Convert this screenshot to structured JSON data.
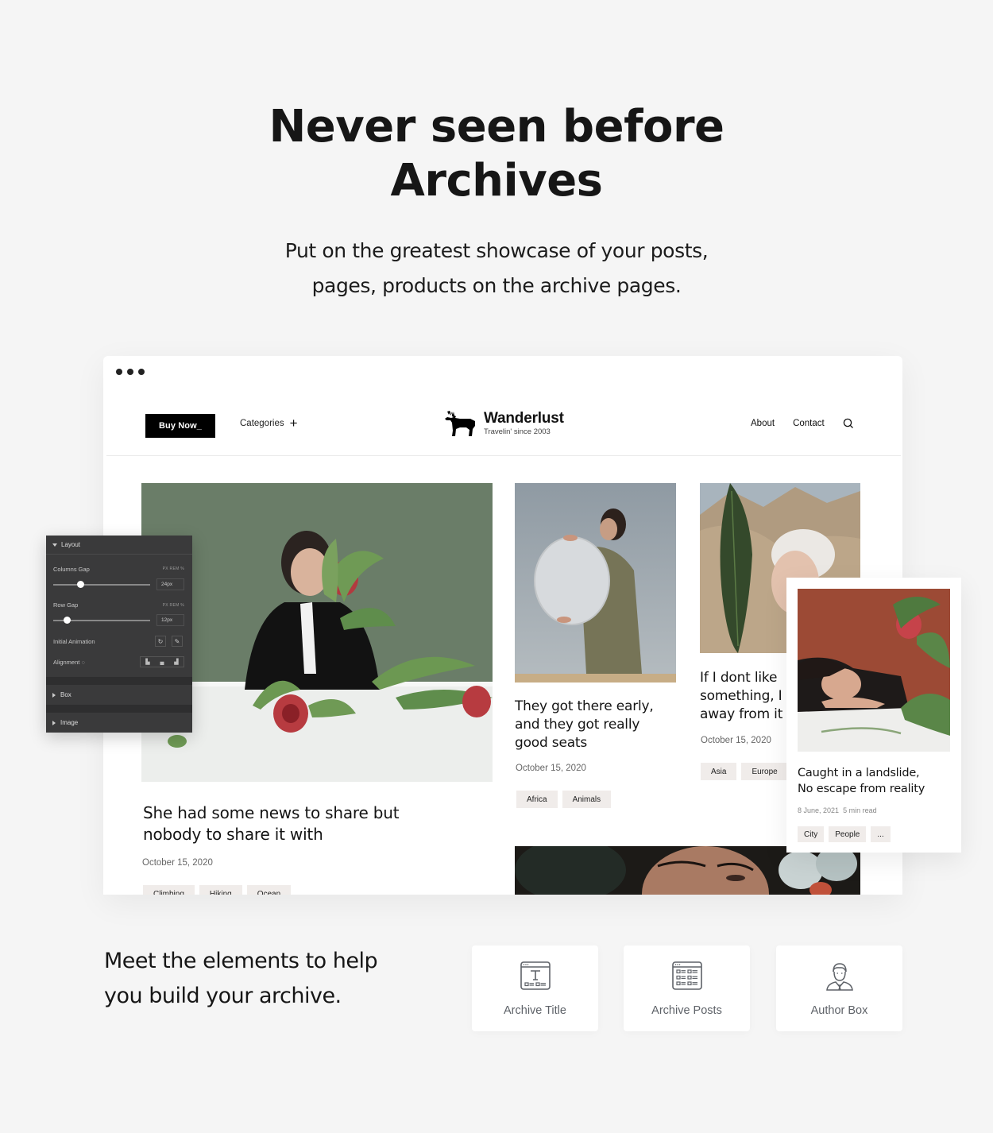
{
  "hero": {
    "title_line1": "Never seen before",
    "title_line2": "Archives",
    "subtitle_line1": "Put on the greatest showcase of your posts,",
    "subtitle_line2": "pages, products on the archive pages."
  },
  "site": {
    "buy_button": "Buy Now_",
    "categories_label": "Categories",
    "logo_name": "Wanderlust",
    "logo_tagline": "Travelin' since 2003",
    "nav": [
      "About",
      "Contact"
    ],
    "icons": {
      "logo": "moose-icon",
      "search": "search-icon",
      "categories": "plus-icon"
    }
  },
  "posts": [
    {
      "title_line1": "She had some news to share but",
      "title_line2": "nobody to share it with",
      "date": "October 15, 2020",
      "tags": [
        "Climbing",
        "Hiking",
        "Ocean"
      ]
    },
    {
      "title_line1": "They got there early,",
      "title_line2": "and they got really",
      "title_line3": "good seats",
      "date": "October 15, 2020",
      "tags": [
        "Africa",
        "Animals"
      ]
    },
    {
      "title_line1": "If I dont like",
      "title_line2": "something, I",
      "title_line3": "away from it",
      "date": "October 15, 2020",
      "tags": [
        "Asia",
        "Europe"
      ]
    }
  ],
  "featured_card": {
    "title_line1": "Caught in a landslide,",
    "title_line2": "No escape from reality",
    "date": "8 June, 2021",
    "read_time": "5 min read",
    "tags": [
      "City",
      "People",
      "..."
    ]
  },
  "editor_panel": {
    "section_layout": "Layout",
    "columns_gap_label": "Columns Gap",
    "columns_gap_value": "24px",
    "columns_gap_slider": 0.28,
    "row_gap_label": "Row Gap",
    "row_gap_value": "12px",
    "row_gap_slider": 0.14,
    "units": "PX  REM  %",
    "initial_animation_label": "Initial Animation",
    "alignment_label": "Alignment",
    "section_box": "Box",
    "section_image": "Image"
  },
  "bottom": {
    "heading_line1": "Meet the elements to help",
    "heading_line2": "you build your archive.",
    "elements": [
      {
        "label": "Archive Title",
        "icon": "archive-title-icon"
      },
      {
        "label": "Archive Posts",
        "icon": "archive-posts-icon"
      },
      {
        "label": "Author Box",
        "icon": "author-box-icon"
      }
    ]
  },
  "colors": {
    "page_bg": "#f5f5f5",
    "panel_bg": "#3a3a3b",
    "tag_bg": "#f0ecea",
    "icon_gray": "#5e6268"
  }
}
